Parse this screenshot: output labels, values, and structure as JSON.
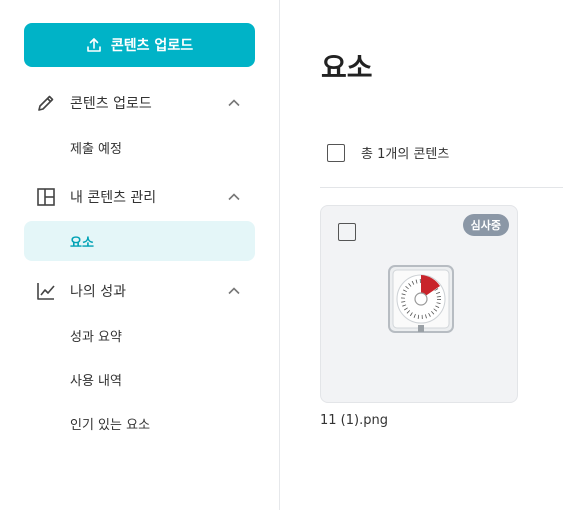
{
  "sidebar": {
    "upload_button_label": "콘텐츠 업로드",
    "sections": [
      {
        "label": "콘텐츠 업로드",
        "icon": "pencil-icon",
        "items": [
          "제출 예정"
        ]
      },
      {
        "label": "내 콘텐츠 관리",
        "icon": "grid-layout-icon",
        "items": [
          "요소"
        ]
      },
      {
        "label": "나의 성과",
        "icon": "line-chart-icon",
        "items": [
          "성과 요약",
          "사용 내역",
          "인기 있는 요소"
        ]
      }
    ],
    "active_item": "요소"
  },
  "main": {
    "title": "요소",
    "count_label": "총 1개의 콘텐츠",
    "items": [
      {
        "filename": "11 (1).png",
        "status_badge": "심사중",
        "thumbnail": "timer-clock-image"
      }
    ]
  },
  "colors": {
    "accent": "#00b3c7",
    "active_bg": "#e4f6f8",
    "active_text": "#00a2b5",
    "badge_bg": "#8b97a6"
  }
}
